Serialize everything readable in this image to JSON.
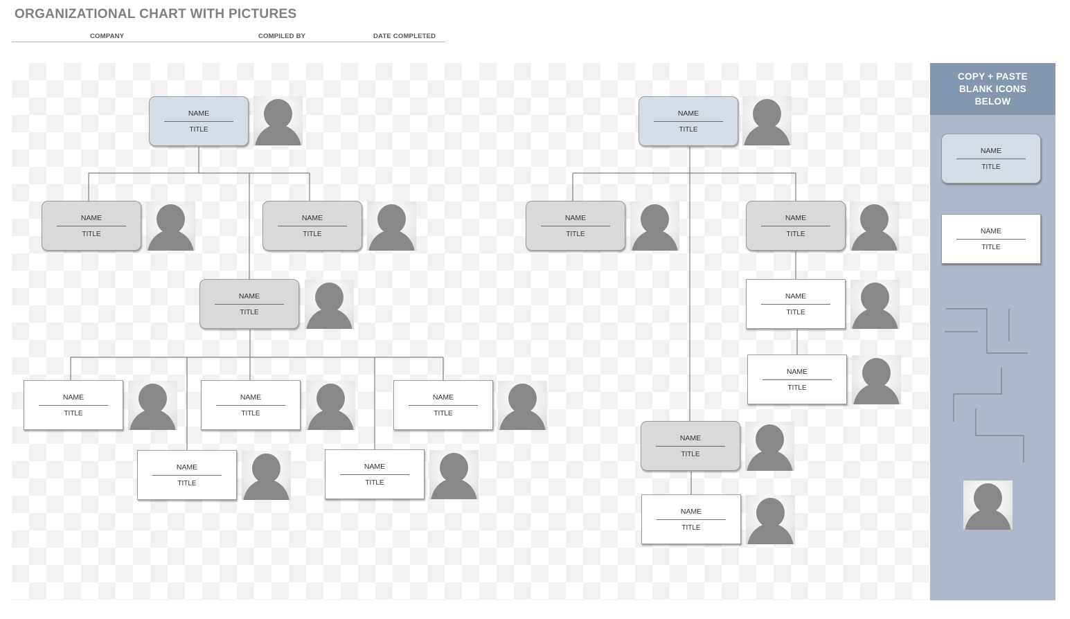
{
  "header": {
    "title": "ORGANIZATIONAL CHART WITH PICTURES",
    "fields": [
      "COMPANY",
      "COMPILED BY",
      "DATE COMPLETED"
    ]
  },
  "node_text": {
    "name": "NAME",
    "title": "TITLE"
  },
  "left_chart": {
    "nodes": [
      {
        "id": "l-root",
        "style": "blue",
        "name": "NAME",
        "title": "TITLE"
      },
      {
        "id": "l-a",
        "style": "gray",
        "name": "NAME",
        "title": "TITLE"
      },
      {
        "id": "l-b",
        "style": "gray",
        "name": "NAME",
        "title": "TITLE"
      },
      {
        "id": "l-c",
        "style": "gray",
        "name": "NAME",
        "title": "TITLE"
      },
      {
        "id": "l-c1",
        "style": "white",
        "name": "NAME",
        "title": "TITLE"
      },
      {
        "id": "l-c2",
        "style": "white",
        "name": "NAME",
        "title": "TITLE"
      },
      {
        "id": "l-c3",
        "style": "white",
        "name": "NAME",
        "title": "TITLE"
      },
      {
        "id": "l-c4",
        "style": "white",
        "name": "NAME",
        "title": "TITLE"
      },
      {
        "id": "l-c5",
        "style": "white",
        "name": "NAME",
        "title": "TITLE"
      }
    ]
  },
  "right_chart": {
    "nodes": [
      {
        "id": "r-root",
        "style": "blue",
        "name": "NAME",
        "title": "TITLE"
      },
      {
        "id": "r-a",
        "style": "gray",
        "name": "NAME",
        "title": "TITLE"
      },
      {
        "id": "r-b",
        "style": "gray",
        "name": "NAME",
        "title": "TITLE"
      },
      {
        "id": "r-b1",
        "style": "white",
        "name": "NAME",
        "title": "TITLE"
      },
      {
        "id": "r-b2",
        "style": "white",
        "name": "NAME",
        "title": "TITLE"
      },
      {
        "id": "r-c",
        "style": "gray",
        "name": "NAME",
        "title": "TITLE"
      },
      {
        "id": "r-c1",
        "style": "white",
        "name": "NAME",
        "title": "TITLE"
      }
    ]
  },
  "side_panel": {
    "heading_lines": [
      "COPY + PASTE",
      "BLANK ICONS",
      "BELOW"
    ],
    "templates": [
      {
        "style": "blue",
        "name": "NAME",
        "title": "TITLE"
      },
      {
        "style": "white",
        "name": "NAME",
        "title": "TITLE"
      }
    ],
    "icons": [
      "connector-lines",
      "person-placeholder"
    ]
  },
  "colors": {
    "panel_header": "#8497b0",
    "panel_body": "#adb9ca",
    "node_blue": "#d6dce5",
    "node_gray": "#d9d9d9",
    "node_white": "#ffffff",
    "connector": "#7f7f7f",
    "avatar": "#888888"
  }
}
